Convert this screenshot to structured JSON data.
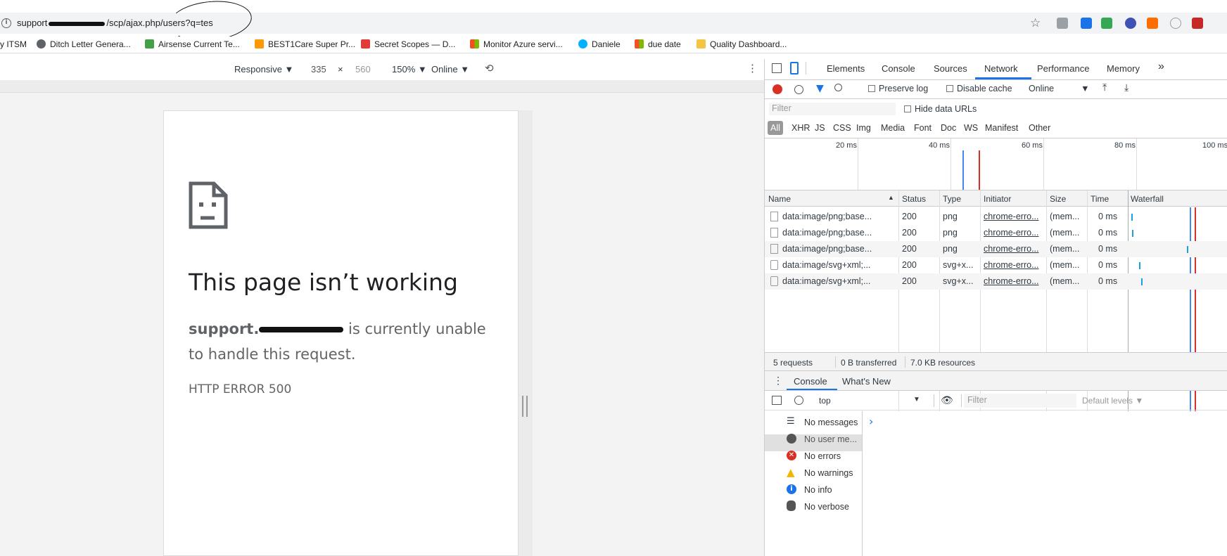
{
  "browser": {
    "url_prefix": "support",
    "url_suffix": "/scp/ajax.php/users?q=tes",
    "bookmarks": [
      {
        "label": "y ITSM",
        "color": "#ffffff"
      },
      {
        "label": "Ditch Letter Genera...",
        "color": "#5f6368"
      },
      {
        "label": "Airsense Current Te...",
        "color": "#0079bf"
      },
      {
        "label": "BEST1Care Super Pr...",
        "color": "#ff9900"
      },
      {
        "label": "Secret Scopes — D...",
        "color": "#e53935"
      },
      {
        "label": "Monitor Azure servi...",
        "color": "#f25022"
      },
      {
        "label": "Daniele",
        "color": "#00b2ff"
      },
      {
        "label": "due date",
        "color": "#f25022"
      },
      {
        "label": "Quality Dashboard...",
        "color": "#f4c542"
      }
    ]
  },
  "device_toolbar": {
    "mode": "Responsive ▼",
    "width": "335",
    "times": "×",
    "height": "560",
    "zoom": "150% ▼",
    "network": "Online ▼"
  },
  "page": {
    "title": "This page isn’t working",
    "host": "support.",
    "body_rest": " is currently unable to handle this request.",
    "error_code": "HTTP ERROR 500"
  },
  "devtools": {
    "tabs": [
      "Elements",
      "Console",
      "Sources",
      "Network",
      "Performance",
      "Memory"
    ],
    "more": "»",
    "active_tab": "Network",
    "preserve_log": "Preserve log",
    "disable_cache": "Disable cache",
    "throttle": "Online",
    "filter_placeholder": "Filter",
    "hide_data_urls": "Hide data URLs",
    "filter_types": [
      "All",
      "XHR",
      "JS",
      "CSS",
      "Img",
      "Media",
      "Font",
      "Doc",
      "WS",
      "Manifest",
      "Other"
    ],
    "timeline_ticks": [
      "20 ms",
      "40 ms",
      "60 ms",
      "80 ms",
      "100 ms"
    ],
    "columns": [
      "Name",
      "Status",
      "Type",
      "Initiator",
      "Size",
      "Time",
      "Waterfall"
    ],
    "rows": [
      {
        "name": "data:image/png;base...",
        "status": "200",
        "type": "png",
        "initiator": "chrome-erro...",
        "size": "(mem...",
        "time": "0 ms"
      },
      {
        "name": "data:image/png;base...",
        "status": "200",
        "type": "png",
        "initiator": "chrome-erro...",
        "size": "(mem...",
        "time": "0 ms"
      },
      {
        "name": "data:image/png;base...",
        "status": "200",
        "type": "png",
        "initiator": "chrome-erro...",
        "size": "(mem...",
        "time": "0 ms"
      },
      {
        "name": "data:image/svg+xml;...",
        "status": "200",
        "type": "svg+x...",
        "initiator": "chrome-erro...",
        "size": "(mem...",
        "time": "0 ms"
      },
      {
        "name": "data:image/svg+xml;...",
        "status": "200",
        "type": "svg+x...",
        "initiator": "chrome-erro...",
        "size": "(mem...",
        "time": "0 ms"
      }
    ],
    "summary": {
      "requests": "5 requests",
      "transferred": "0 B transferred",
      "resources": "7.0 KB resources"
    },
    "drawer_tabs": [
      "Console",
      "What's New"
    ],
    "console_context": "top",
    "console_filter": "Filter",
    "default_levels": "Default levels ▼",
    "levels": [
      "No messages",
      "No user me...",
      "No errors",
      "No warnings",
      "No info",
      "No verbose"
    ],
    "prompt": "›"
  },
  "colors": {
    "accent": "#1a73e8",
    "record": "#d93025"
  }
}
